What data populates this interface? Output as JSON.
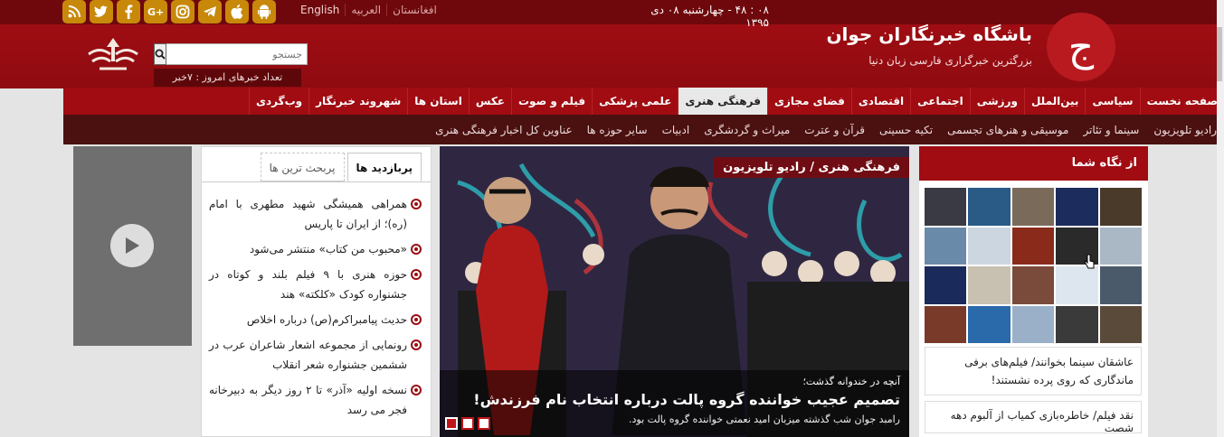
{
  "header": {
    "site_title": "باشگاه خبرنگاران جوان",
    "site_subtitle": "بزرگترین خبرگزاری فارسی زبان دنیا",
    "logo_letter": "ج",
    "datetime": "۰۸ : ۴۸ - چهارشنبه ۰۸ دی ۱۳۹۵",
    "languages": [
      "English",
      "العربیه",
      "افغانستان"
    ],
    "search_placeholder": "جستجو",
    "news_count": "تعداد خبرهای امروز : ۷خبر",
    "socials": [
      "rss-icon",
      "twitter-icon",
      "facebook-icon",
      "googleplus-icon",
      "instagram-icon",
      "telegram-icon",
      "apple-icon",
      "android-icon"
    ]
  },
  "main_nav": [
    {
      "label": "صفحه نخست",
      "active": false
    },
    {
      "label": "سیاسی",
      "active": false
    },
    {
      "label": "بین‌الملل",
      "active": false
    },
    {
      "label": "ورزشی",
      "active": false
    },
    {
      "label": "اجتماعی",
      "active": false
    },
    {
      "label": "اقتصادی",
      "active": false
    },
    {
      "label": "فضای مجازی",
      "active": false
    },
    {
      "label": "فرهنگی هنری",
      "active": true
    },
    {
      "label": "علمی پزشکی",
      "active": false
    },
    {
      "label": "فیلم و صوت",
      "active": false
    },
    {
      "label": "عکس",
      "active": false
    },
    {
      "label": "استان ها",
      "active": false
    },
    {
      "label": "شهروند خبرنگار",
      "active": false
    },
    {
      "label": "وب‌گردی",
      "active": false
    }
  ],
  "sub_nav": [
    "رادیو تلویزیون",
    "سینما و تئاتر",
    "موسیقی و هنرهای تجسمی",
    "تکیه حسینی",
    "قرآن و عترت",
    "میراث و گردشگری",
    "ادبیات",
    "سایر حوزه ها",
    "عناوین کل اخبار فرهنگی هنری"
  ],
  "list_panel": {
    "tabs": [
      "پربازدید ها",
      "پربحث ترین ها"
    ],
    "items": [
      "همراهی همیشگی شهید مطهری با امام (ره)؛ از ایران تا پاریس",
      "«محبوب من کتاب» منتشر می‌شود",
      "حوزه هنری با ۹ فیلم بلند و کوتاه در جشنواره کودک «کلکته» هند",
      "حدیث پیامبراکرم(ص) درباره اخلاص",
      "رونمایی از مجموعه اشعار شاعران عرب در ششمین جشنواره شعر انقلاب",
      "نسخه اولیه «آذر» تا ۲ روز دیگر به دبیرخانه فجر می رسد"
    ]
  },
  "hero": {
    "tag": "فرهنگی هنری / رادیو تلویزیون",
    "pre_title": "آنچه در خندوانه گذشت؛",
    "title": "تصمیم عجیب خواننده گروه پالت درباره انتخاب نام فرزندش!",
    "lead": "رامبد جوان شب گذشته میزبان امید نعمتی خواننده گروه پالت بود."
  },
  "sidebar": {
    "heading": "از نگاه شما",
    "item1": "عاشقان سینما بخوانند/ فیلم‌های برفی ماندگاری که روی پرده نشستند!",
    "item2": "نقد فیلم/ خاطره‌بازی کمیاب از آلبوم دهه شصت"
  }
}
